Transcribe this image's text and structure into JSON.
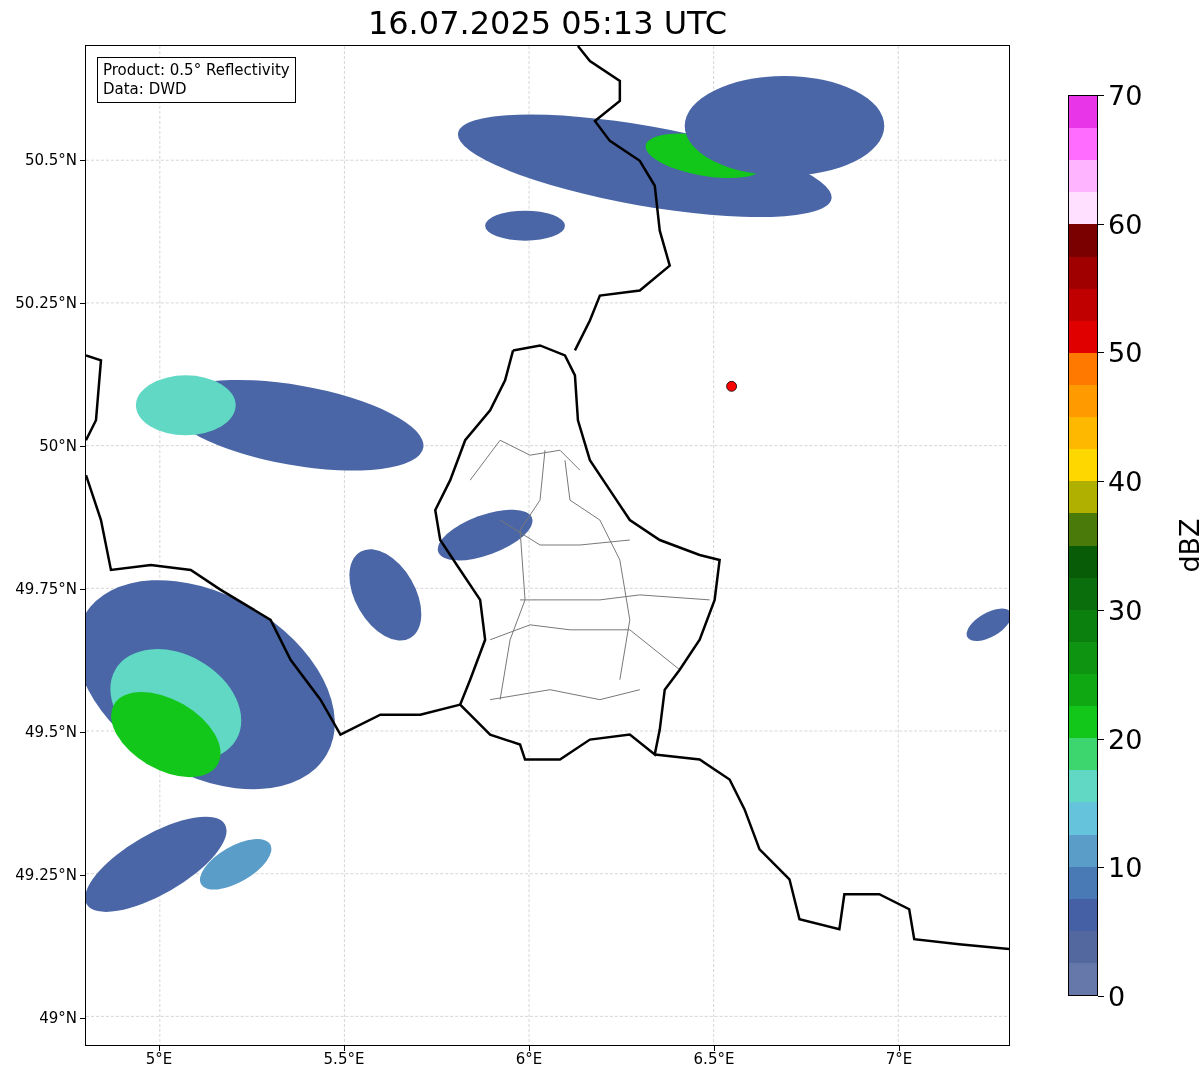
{
  "title": "16.07.2025 05:13 UTC",
  "info_box": {
    "lines": [
      "Product: 0.5° Reflectivity",
      "Data: DWD"
    ]
  },
  "map": {
    "y_ticks": [
      "50.5°N",
      "50.25°N",
      "50°N",
      "49.75°N",
      "49.5°N",
      "49.25°N",
      "49°N"
    ],
    "x_ticks": [
      "5°E",
      "5.5°E",
      "6°E",
      "6.5°E",
      "7°E"
    ]
  },
  "colorbar": {
    "label": "dBZ",
    "ticks": [
      "70",
      "60",
      "50",
      "40",
      "30",
      "20",
      "10",
      "0"
    ],
    "bands": [
      {
        "color": "#e835e8"
      },
      {
        "color": "#ff6cff"
      },
      {
        "color": "#ffb4ff"
      },
      {
        "color": "#ffe0ff"
      },
      {
        "color": "#7a0000"
      },
      {
        "color": "#a00000"
      },
      {
        "color": "#c00000"
      },
      {
        "color": "#e00000"
      },
      {
        "color": "#ff7800"
      },
      {
        "color": "#ff9a00"
      },
      {
        "color": "#ffb800"
      },
      {
        "color": "#ffd700"
      },
      {
        "color": "#b0b000"
      },
      {
        "color": "#4a7a0a"
      },
      {
        "color": "#085c08"
      },
      {
        "color": "#0a6e0c"
      },
      {
        "color": "#0c800e"
      },
      {
        "color": "#0e9410"
      },
      {
        "color": "#10a812"
      },
      {
        "color": "#12c71a"
      },
      {
        "color": "#3dd66e"
      },
      {
        "color": "#60d8c4"
      },
      {
        "color": "#65c3dc"
      },
      {
        "color": "#5a9dc8"
      },
      {
        "color": "#4a7ab5"
      },
      {
        "color": "#4560a4"
      },
      {
        "color": "#53689f"
      },
      {
        "color": "#6677aa"
      }
    ]
  }
}
